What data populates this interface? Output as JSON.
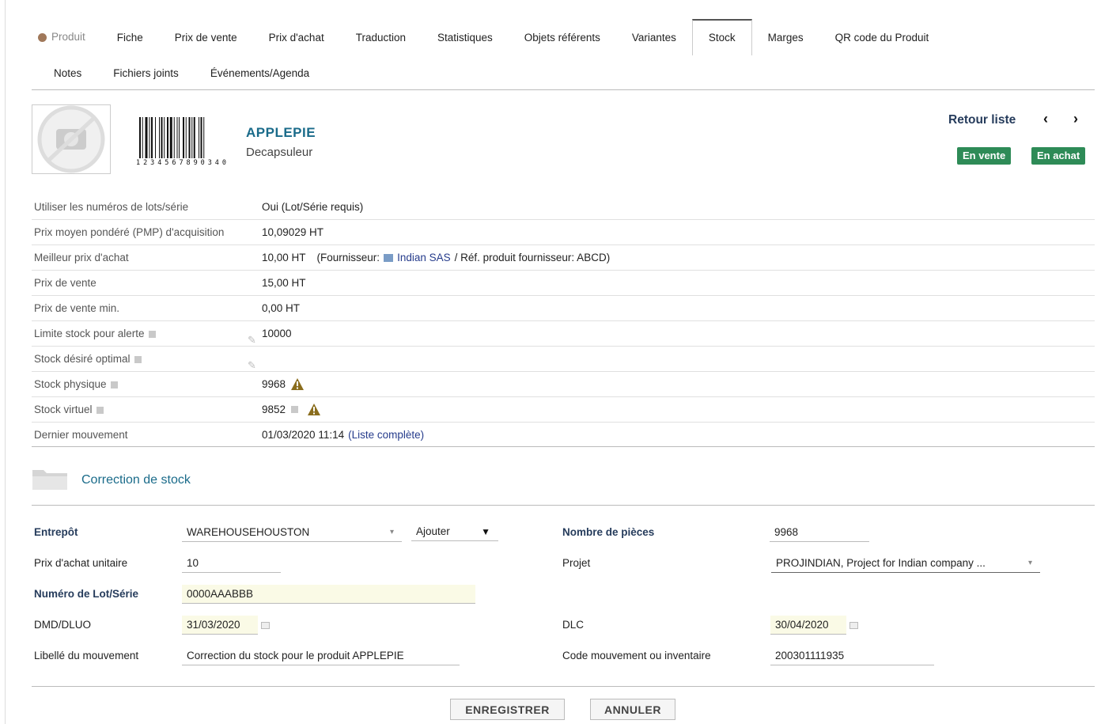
{
  "tabs": {
    "row1": [
      "Produit",
      "Fiche",
      "Prix de vente",
      "Prix d'achat",
      "Traduction",
      "Statistiques",
      "Objets référents",
      "Variantes",
      "Stock",
      "Marges",
      "QR code du Produit"
    ],
    "row2": [
      "Notes",
      "Fichiers joints",
      "Événements/Agenda"
    ],
    "active": "Stock"
  },
  "product": {
    "ref": "APPLEPIE",
    "label": "Decapsuleur",
    "barcode_text": "1234567890340",
    "back_label": "Retour liste",
    "prev_icon": "chevron-left-icon",
    "next_icon": "chevron-right-icon",
    "badge_sell": "En vente",
    "badge_buy": "En achat",
    "badge_color": "#2e8b57"
  },
  "details": [
    {
      "label": "Utiliser les numéros de lots/série",
      "value": "Oui (Lot/Série requis)"
    },
    {
      "label": "Prix moyen pondéré (PMP) d'acquisition",
      "value": "10,09029 HT"
    },
    {
      "label": "Meilleur prix d'achat",
      "value": "10,00 HT",
      "supplier_prefix": "(Fournisseur:",
      "supplier_name": "Indian SAS",
      "supplier_suffix": "/ Réf. produit fournisseur: ABCD)"
    },
    {
      "label": "Prix de vente",
      "value": "15,00 HT"
    },
    {
      "label": "Prix de vente min.",
      "value": "0,00 HT"
    },
    {
      "label": "Limite stock pour alerte",
      "value": "10000"
    },
    {
      "label": "Stock désiré optimal",
      "value": ""
    },
    {
      "label": "Stock physique",
      "value": "9968"
    },
    {
      "label": "Stock virtuel",
      "value": "9852"
    },
    {
      "label": "Dernier mouvement",
      "value": "01/03/2020 11:14",
      "link": "(Liste complète)"
    }
  ],
  "correction": {
    "title": "Correction de stock",
    "warehouse_label": "Entrepôt",
    "warehouse_value": "WAREHOUSEHOUSTON",
    "action_value": "Ajouter",
    "pieces_label": "Nombre de pièces",
    "pieces_value": "9968",
    "unit_price_label": "Prix d'achat unitaire",
    "unit_price_value": "10",
    "project_label": "Projet",
    "project_value": "PROJINDIAN, Project for Indian company ...",
    "lot_label": "Numéro de Lot/Série",
    "lot_value": "0000AAABBB",
    "dmd_label": "DMD/DLUO",
    "dmd_value": "31/03/2020",
    "dlc_label": "DLC",
    "dlc_value": "30/04/2020",
    "movement_label": "Libellé du mouvement",
    "movement_value": "Correction du stock pour le produit APPLEPIE",
    "code_label": "Code mouvement ou inventaire",
    "code_value": "200301111935"
  },
  "buttons": {
    "save": "ENREGISTRER",
    "cancel": "ANNULER"
  }
}
